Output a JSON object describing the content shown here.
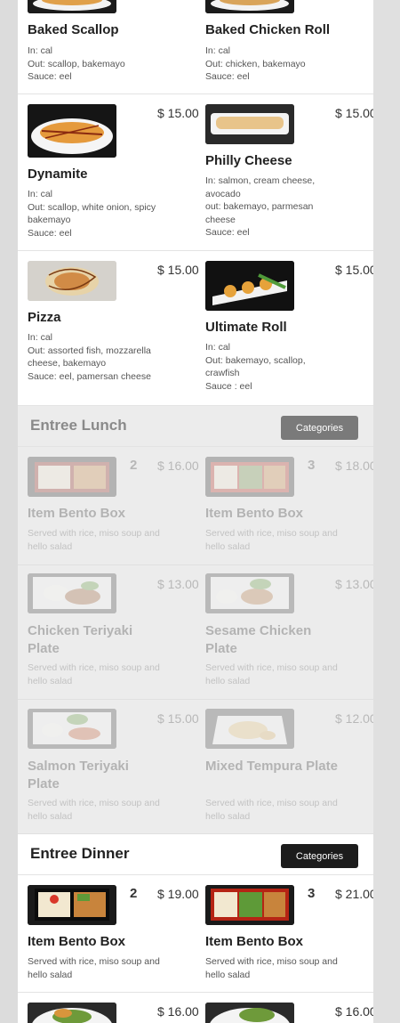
{
  "colors": {
    "page_bg": "#ffffff",
    "outer_bg": "#dcdcdc",
    "dim_bg": "#ececec",
    "button_dark": "#1c1c1c",
    "button_grey": "#7a7a7a"
  },
  "sections": {
    "lunch": {
      "title": "Entree Lunch",
      "button_label": "Categories"
    },
    "dinner": {
      "title": "Entree Dinner",
      "button_label": "Categories"
    }
  },
  "rolls": {
    "baked_scallop": {
      "name": "Baked Scallop",
      "desc": [
        "In: cal",
        "Out: scallop, bakemayo",
        "Sauce: eel"
      ]
    },
    "baked_chicken_roll": {
      "name": "Baked Chicken Roll",
      "desc": [
        "In: cal",
        "Out: chicken, bakemayo",
        "Sauce: eel"
      ]
    },
    "dynamite": {
      "name": "Dynamite",
      "price": "$ 15.00",
      "desc": [
        "In: cal",
        "Out: scallop, white onion, spicy bakemayo",
        "Sauce: eel"
      ],
      "icon": "dynamite-roll-photo"
    },
    "philly_cheese": {
      "name": "Philly Cheese",
      "price": "$ 15.00",
      "desc": [
        "In: salmon, cream cheese, avocado",
        "out: bakemayo, parmesan cheese",
        "Sauce: eel"
      ],
      "icon": "philly-roll-photo"
    },
    "pizza": {
      "name": "Pizza",
      "price": "$ 15.00",
      "desc": [
        "In: cal",
        "Out: assorted fish, mozzarella cheese, bakemayo",
        "Sauce: eel, pamersan cheese"
      ],
      "icon": "pizza-roll-photo"
    },
    "ultimate_roll": {
      "name": "Ultimate Roll",
      "price": "$ 15.00",
      "desc": [
        "In: cal",
        "Out: bakemayo, scallop, crawfish",
        "Sauce : eel"
      ],
      "icon": "ultimate-roll-photo"
    }
  },
  "lunch_items": {
    "bento2": {
      "name": "Item Bento Box",
      "qty": "2",
      "price": "$ 16.00",
      "desc": "Served with rice, miso soup and hello salad"
    },
    "bento3": {
      "name": "Item Bento Box",
      "qty": "3",
      "price": "$ 18.00",
      "desc": "Served with rice, miso soup and hello salad"
    },
    "chicken_teriyaki": {
      "name": "Chicken Teriyaki Plate",
      "price": "$ 13.00",
      "desc": "Served with rice, miso soup and hello salad"
    },
    "sesame_chicken": {
      "name": "Sesame Chicken Plate",
      "price": "$ 13.00",
      "desc": "Served with rice, miso soup and hello salad"
    },
    "salmon_teriyaki": {
      "name": "Salmon Teriyaki Plate",
      "price": "$ 15.00",
      "desc": "Served with rice, miso soup and hello salad"
    },
    "mixed_tempura": {
      "name": "Mixed Tempura Plate",
      "price": "$ 12.00",
      "desc": "Served with rice, miso soup and hello salad"
    }
  },
  "dinner_items": {
    "bento2": {
      "name": "Item Bento Box",
      "qty": "2",
      "price": "$ 19.00",
      "desc": "Served with rice, miso soup and hello salad"
    },
    "bento3": {
      "name": "Item Bento Box",
      "qty": "3",
      "price": "$ 21.00",
      "desc": "Served with rice, miso soup and hello salad"
    },
    "next_left": {
      "price": "$ 16.00"
    },
    "next_right": {
      "price": "$ 16.00"
    }
  }
}
